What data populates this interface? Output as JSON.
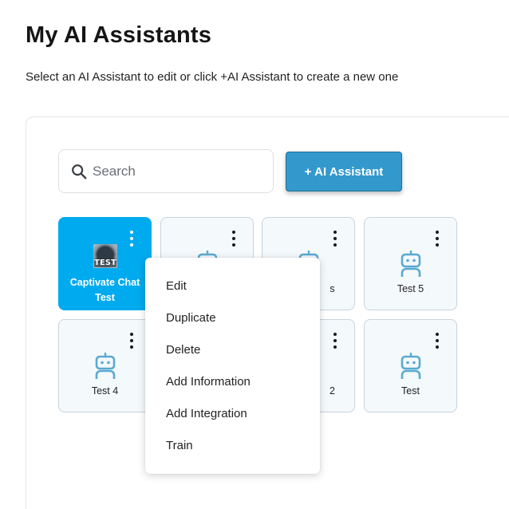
{
  "page": {
    "title": "My AI Assistants",
    "subtitle": "Select an AI Assistant to edit or click +AI Assistant to create a new one"
  },
  "search": {
    "placeholder": "Search",
    "value": ""
  },
  "add_button": {
    "label": "+ AI Assistant"
  },
  "colors": {
    "accent": "#3399cc",
    "selected_card": "#00aaee",
    "robot_icon": "#5aaad0"
  },
  "assistants": [
    {
      "name": "Captivate Chat Test",
      "avatar_text": "TEST",
      "selected": true
    },
    {
      "name": "",
      "selected": false
    },
    {
      "name": "s",
      "selected": false
    },
    {
      "name": "Test 5",
      "selected": false
    },
    {
      "name": "Test 4",
      "selected": false
    },
    {
      "name": "",
      "selected": false
    },
    {
      "name": "2",
      "selected": false
    },
    {
      "name": "Test",
      "selected": false
    }
  ],
  "context_menu": {
    "items": [
      "Edit",
      "Duplicate",
      "Delete",
      "Add Information",
      "Add Integration",
      "Train"
    ]
  }
}
